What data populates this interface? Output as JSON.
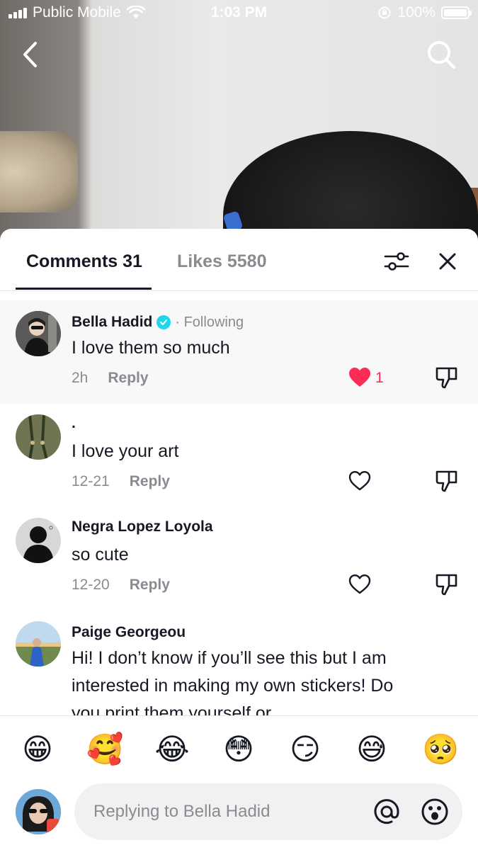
{
  "status_bar": {
    "carrier": "Public Mobile",
    "time": "1:03 PM",
    "battery": "100%"
  },
  "tabs": {
    "comments": "Comments 31",
    "likes": "Likes 5580"
  },
  "comments": [
    {
      "author": "Bella Hadid",
      "verified": true,
      "relation": "· Following",
      "text": "I love them so much",
      "time": "2h",
      "reply": "Reply",
      "liked": true,
      "like_count": "1"
    },
    {
      "author": ".",
      "text": "I love your art",
      "time": "12-21",
      "reply": "Reply",
      "liked": false
    },
    {
      "author": "Negra Lopez Loyola",
      "text": "so cute",
      "time": "12-20",
      "reply": "Reply",
      "liked": false
    },
    {
      "author": "Paige Georgeou",
      "text": "Hi! I don’t know if you’ll see this but I am interested in making my own stickers! Do you print them yourself or",
      "liked": false
    }
  ],
  "quick_emojis": [
    "😁",
    "🥰",
    "😂",
    "😳",
    "😏",
    "😅",
    "🥺"
  ],
  "composer": {
    "placeholder": "Replying to Bella Hadid"
  },
  "icons": {
    "back": "back-chevron-icon",
    "search": "search-icon",
    "filter": "filter-sliders-icon",
    "close": "close-icon",
    "heart": "heart-icon",
    "dislike": "thumbs-down-icon",
    "mention": "at-sign-icon",
    "emoji": "emoji-face-icon"
  },
  "colors": {
    "accent_red": "#fe2c55",
    "verified_blue": "#20d5ec",
    "muted_text": "#8a8b91"
  }
}
